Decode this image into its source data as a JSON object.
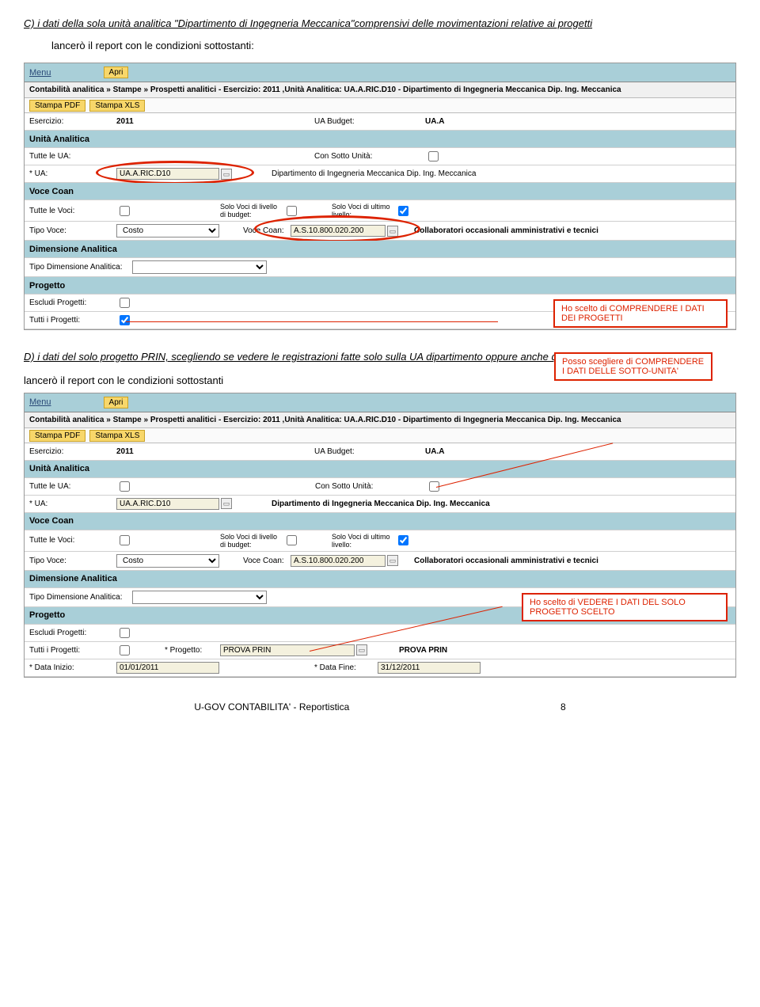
{
  "intro1": {
    "title": "C) i dati della sola unità analitica \"Dipartimento di Ingegneria Meccanica\"comprensivi delle movimentazioni relative ai progetti",
    "subtitle": "lancerò il report con le condizioni sottostanti:"
  },
  "win1": {
    "menu": "Menu",
    "apri": "Apri",
    "breadcrumb": "Contabilità analitica » Stampe » Prospetti analitici - Esercizio: 2011 ,Unità Analitica: UA.A.RIC.D10 - Dipartimento di Ingegneria Meccanica Dip. Ing. Meccanica",
    "btn_pdf": "Stampa PDF",
    "btn_xls": "Stampa XLS",
    "esercizio_lbl": "Esercizio:",
    "esercizio_val": "2011",
    "uabudget_lbl": "UA Budget:",
    "uabudget_val": "UA.A",
    "sec_ua": "Unità Analitica",
    "tutte_ua_lbl": "Tutte le UA:",
    "con_sotto_lbl": "Con Sotto Unità:",
    "ua_lbl": "* UA:",
    "ua_val": "UA.A.RIC.D10",
    "ua_desc": "Dipartimento di Ingegneria Meccanica Dip. Ing. Meccanica",
    "sec_voce": "Voce Coan",
    "tutte_voci_lbl": "Tutte le Voci:",
    "solo_budget_lbl": "Solo Voci di livello di budget:",
    "solo_ultimo_lbl": "Solo Voci di ultimo livello:",
    "tipo_voce_lbl": "Tipo Voce:",
    "tipo_voce_val": "Costo",
    "voce_coan_lbl": "Voce Coan:",
    "voce_coan_val": "A.S.10.800.020.200",
    "voce_coan_desc": "Collaboratori occasionali amministrativi e tecnici",
    "sec_dim": "Dimensione Analitica",
    "tipo_dim_lbl": "Tipo Dimensione Analitica:",
    "sec_prog": "Progetto",
    "escludi_lbl": "Escludi Progetti:",
    "tutti_prog_lbl": "Tutti i Progetti:"
  },
  "annotation1": "Ho scelto di COMPRENDERE I DATI DEI PROGETTI",
  "intro2": {
    "title": "D) i dati del solo progetto PRIN, scegliendo se vedere le registrazioni fatte solo sulla UA dipartimento oppure anche quelle fatte sulle sotto Unità",
    "subtitle": "lancerò il report con le condizioni sottostanti"
  },
  "annotation2": "Posso scegliere di COMPRENDERE I DATI DELLE SOTTO-UNITA'",
  "win2": {
    "progetto_lbl": "* Progetto:",
    "progetto_val": "PROVA PRIN",
    "progetto_desc": "PROVA PRIN",
    "data_inizio_lbl": "* Data Inizio:",
    "data_inizio_val": "01/01/2011",
    "data_fine_lbl": "* Data Fine:",
    "data_fine_val": "31/12/2011"
  },
  "annotation3": "Ho scelto di VEDERE I DATI DEL SOLO PROGETTO SCELTO",
  "footer": "U-GOV CONTABILITA' - Reportistica",
  "page": "8"
}
